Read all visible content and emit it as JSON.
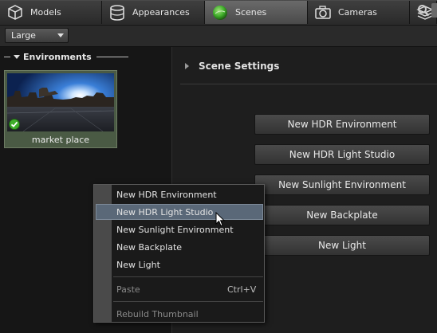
{
  "tabs": [
    {
      "label": "Models",
      "icon": "cube-icon"
    },
    {
      "label": "Appearances",
      "icon": "cylinder-icon"
    },
    {
      "label": "Scenes",
      "icon": "sphere-icon"
    },
    {
      "label": "Cameras",
      "icon": "camera-icon"
    },
    {
      "label": "",
      "icon": "layers-icon"
    }
  ],
  "toolbar": {
    "thumbnail_size": "Large"
  },
  "environments": {
    "header": "Environments",
    "items": [
      {
        "label": "market place",
        "selected": true
      }
    ]
  },
  "scene_settings": {
    "header": "Scene Settings",
    "buttons": [
      "New HDR Environment",
      "New HDR Light Studio",
      "New Sunlight Environment",
      "New Backplate",
      "New Light"
    ]
  },
  "context_menu": {
    "items": [
      {
        "label": "New HDR Environment",
        "enabled": true
      },
      {
        "label": "New HDR Light Studio",
        "enabled": true,
        "highlighted": true
      },
      {
        "label": "New Sunlight Environment",
        "enabled": true
      },
      {
        "label": "New Backplate",
        "enabled": true
      },
      {
        "label": "New Light",
        "enabled": true
      },
      {
        "label": "Paste",
        "enabled": false,
        "shortcut": "Ctrl+V"
      },
      {
        "label": "Rebuild Thumbnail",
        "enabled": false
      }
    ]
  },
  "colors": {
    "accent_green": "#3fae2a",
    "highlight": "#5a6878"
  }
}
